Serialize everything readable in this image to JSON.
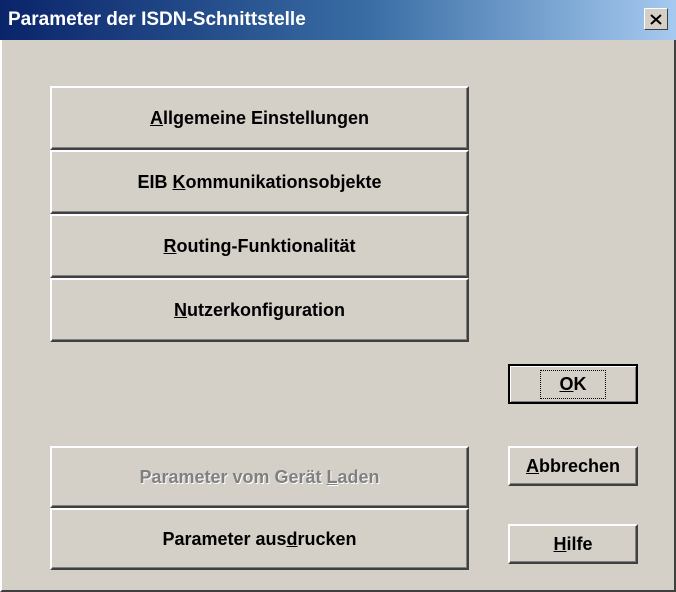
{
  "dialog": {
    "title": "Parameter der ISDN-Schnittstelle"
  },
  "buttons": {
    "allgemeine": {
      "pre": "",
      "key": "A",
      "post": "llgemeine Einstellungen"
    },
    "eib": {
      "pre": "EIB ",
      "key": "K",
      "post": "ommunikationsobjekte"
    },
    "routing": {
      "pre": "",
      "key": "R",
      "post": "outing-Funktionalität"
    },
    "nutzer": {
      "pre": "",
      "key": "N",
      "post": "utzerkonfiguration"
    },
    "laden": {
      "pre": "Parameter vom Gerät ",
      "key": "L",
      "post": "aden"
    },
    "drucken": {
      "pre": "Parameter aus",
      "key": "d",
      "post": "rucken"
    },
    "ok": {
      "pre": "",
      "key": "O",
      "post": "K"
    },
    "abbrechen": {
      "pre": "",
      "key": "A",
      "post": "bbrechen"
    },
    "hilfe": {
      "pre": "",
      "key": "H",
      "post": "ilfe"
    }
  }
}
